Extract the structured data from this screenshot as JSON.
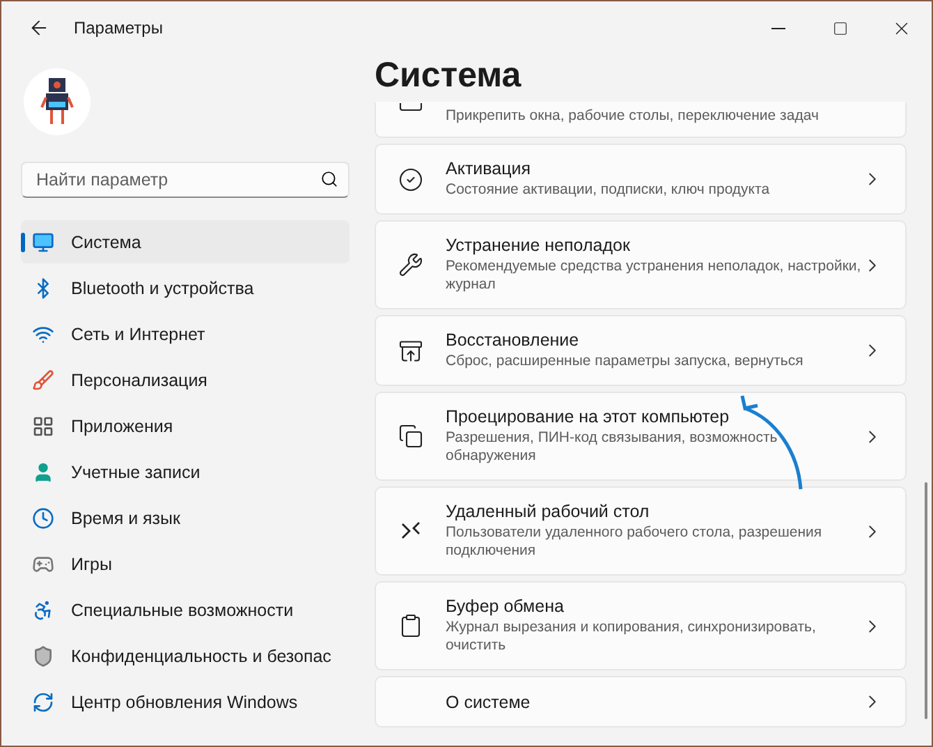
{
  "window": {
    "title": "Параметры"
  },
  "search": {
    "placeholder": "Найти параметр"
  },
  "sidebar": {
    "items": [
      {
        "label": "Система",
        "selected": true
      },
      {
        "label": "Bluetooth и устройства",
        "selected": false
      },
      {
        "label": "Сеть и Интернет",
        "selected": false
      },
      {
        "label": "Персонализация",
        "selected": false
      },
      {
        "label": "Приложения",
        "selected": false
      },
      {
        "label": "Учетные записи",
        "selected": false
      },
      {
        "label": "Время и язык",
        "selected": false
      },
      {
        "label": "Игры",
        "selected": false
      },
      {
        "label": "Специальные возможности",
        "selected": false
      },
      {
        "label": "Конфиденциальность и безопас",
        "selected": false
      },
      {
        "label": "Центр обновления Windows",
        "selected": false
      }
    ]
  },
  "page": {
    "title": "Система",
    "cards": [
      {
        "description": "Прикрепить окна, рабочие столы, переключение задач"
      },
      {
        "title": "Активация",
        "description": "Состояние активации, подписки, ключ продукта"
      },
      {
        "title": "Устранение неполадок",
        "description": "Рекомендуемые средства устранения неполадок, настройки, журнал"
      },
      {
        "title": "Восстановление",
        "description": "Сброс, расширенные параметры запуска, вернуться"
      },
      {
        "title": "Проецирование на этот компьютер",
        "description": "Разрешения, ПИН-код связывания, возможность обнаружения"
      },
      {
        "title": "Удаленный рабочий стол",
        "description": "Пользователи удаленного рабочего стола, разрешения подключения"
      },
      {
        "title": "Буфер обмена",
        "description": "Журнал вырезания и копирования, синхронизировать, очистить"
      },
      {
        "title": "О системе"
      }
    ]
  }
}
